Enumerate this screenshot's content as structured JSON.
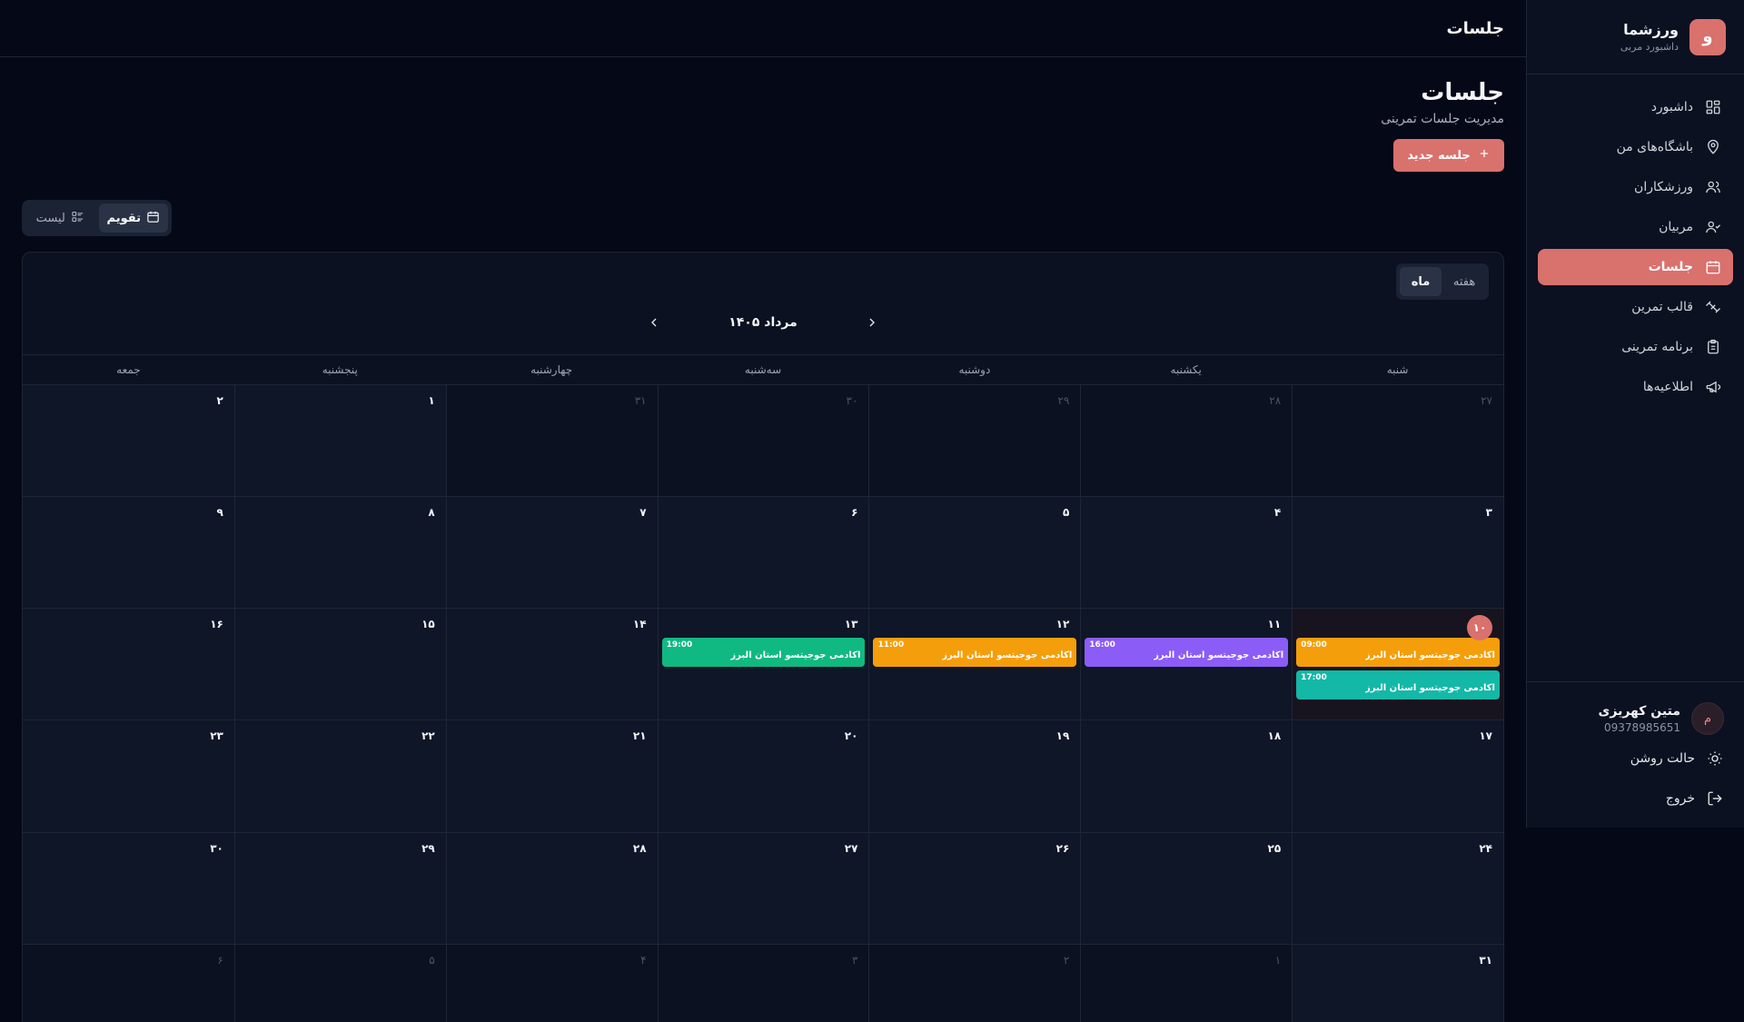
{
  "brand": {
    "logo_letter": "و",
    "name": "ورزشما",
    "subtitle": "داشبورد مربی"
  },
  "nav": [
    {
      "label": "داشبورد",
      "icon": "dashboard-icon"
    },
    {
      "label": "باشگاه‌های من",
      "icon": "map-pin-icon"
    },
    {
      "label": "ورزشکاران",
      "icon": "users-icon"
    },
    {
      "label": "مربیان",
      "icon": "user-check-icon"
    },
    {
      "label": "جلسات",
      "icon": "calendar-icon",
      "active": true
    },
    {
      "label": "قالب تمرین",
      "icon": "dumbbell-icon"
    },
    {
      "label": "برنامه تمرینی",
      "icon": "clipboard-icon"
    },
    {
      "label": "اطلاعیه‌ها",
      "icon": "megaphone-icon"
    }
  ],
  "user": {
    "avatar_letter": "م",
    "name": "متین کهریزی",
    "phone": "09378985651"
  },
  "theme_toggle_label": "حالت روشن",
  "logout_label": "خروج",
  "topbar": {
    "title": "جلسات"
  },
  "page": {
    "title": "جلسات",
    "subtitle": "مدیریت جلسات تمرینی",
    "new_button": "جلسه جدید"
  },
  "view_toggle": {
    "calendar": "تقویم",
    "list": "لیست",
    "active": "calendar"
  },
  "calendar": {
    "range": {
      "week": "هفته",
      "month": "ماه",
      "active": "month"
    },
    "month_label": "مرداد ۱۴۰۵",
    "weekdays": [
      "شنبه",
      "یکشنبه",
      "دوشنبه",
      "سه‌شنبه",
      "چهارشنبه",
      "پنجشنبه",
      "جمعه"
    ],
    "weeks": [
      [
        {
          "d": "۲۷",
          "out": true
        },
        {
          "d": "۲۸",
          "out": true
        },
        {
          "d": "۲۹",
          "out": true
        },
        {
          "d": "۳۰",
          "out": true
        },
        {
          "d": "۳۱",
          "out": true
        },
        {
          "d": "۱"
        },
        {
          "d": "۲"
        }
      ],
      [
        {
          "d": "۳"
        },
        {
          "d": "۴"
        },
        {
          "d": "۵"
        },
        {
          "d": "۶"
        },
        {
          "d": "۷"
        },
        {
          "d": "۸"
        },
        {
          "d": "۹"
        }
      ],
      [
        {
          "d": "۱۰",
          "today": true,
          "events": [
            {
              "time": "09:00",
              "title": "آکادمی جوجیتسو استان البرز",
              "color": "#f59e0b"
            },
            {
              "time": "17:00",
              "title": "آکادمی جوجیتسو استان البرز",
              "color": "#14b8a6"
            }
          ]
        },
        {
          "d": "۱۱",
          "events": [
            {
              "time": "16:00",
              "title": "آکادمی جوجیتسو استان البرز",
              "color": "#8b5cf6"
            }
          ]
        },
        {
          "d": "۱۲",
          "events": [
            {
              "time": "11:00",
              "title": "آکادمی جوجیتسو استان البرز",
              "color": "#f59e0b"
            }
          ]
        },
        {
          "d": "۱۳",
          "events": [
            {
              "time": "19:00",
              "title": "آکادمی جوجیتسو استان البرز",
              "color": "#10b981"
            }
          ]
        },
        {
          "d": "۱۴"
        },
        {
          "d": "۱۵"
        },
        {
          "d": "۱۶"
        }
      ],
      [
        {
          "d": "۱۷"
        },
        {
          "d": "۱۸"
        },
        {
          "d": "۱۹"
        },
        {
          "d": "۲۰"
        },
        {
          "d": "۲۱"
        },
        {
          "d": "۲۲"
        },
        {
          "d": "۲۳"
        }
      ],
      [
        {
          "d": "۲۴"
        },
        {
          "d": "۲۵"
        },
        {
          "d": "۲۶"
        },
        {
          "d": "۲۷"
        },
        {
          "d": "۲۸"
        },
        {
          "d": "۲۹"
        },
        {
          "d": "۳۰"
        }
      ],
      [
        {
          "d": "۳۱"
        },
        {
          "d": "۱",
          "out": true
        },
        {
          "d": "۲",
          "out": true
        },
        {
          "d": "۳",
          "out": true
        },
        {
          "d": "۴",
          "out": true
        },
        {
          "d": "۵",
          "out": true
        },
        {
          "d": "۶",
          "out": true
        }
      ]
    ]
  },
  "colors": {
    "accent": "#d9716d",
    "background": "#050816",
    "panel": "#0b1120"
  }
}
